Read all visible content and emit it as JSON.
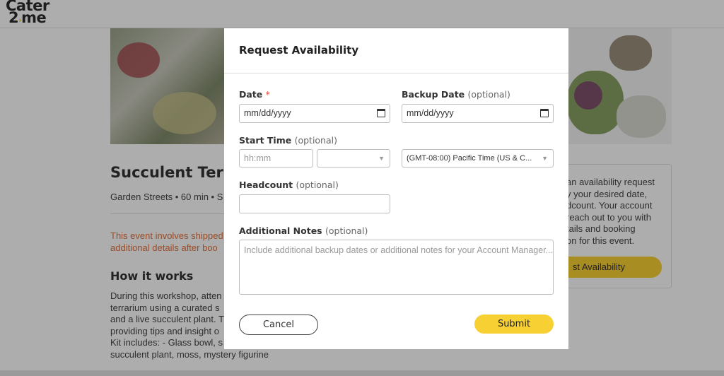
{
  "app": {
    "logo_line1": "Cater",
    "logo_two": "2",
    "logo_me": "me"
  },
  "page": {
    "title": "Succulent Terra",
    "meta": "Garden Streets • 60 min • S",
    "warning_line1": "This event involves shipped",
    "warning_line2": "additional details after boo",
    "how_heading": "How it works",
    "desc_lines": [
      "During this workshop, atten",
      "terrarium using a curated s",
      "and a live succulent plant. T",
      "providing tips and insight o",
      "Kit includes: - Glass bowl, s",
      "succulent plant, moss, mystery figurine"
    ]
  },
  "side_card": {
    "lines": [
      "an availability request",
      "y your desired date,",
      "dcount. Your account",
      "reach out to you with",
      "tails and booking",
      "on for this event."
    ],
    "button_label": "st Availability"
  },
  "modal": {
    "title": "Request Availability",
    "date_label": "Date",
    "date_required": "*",
    "date_placeholder": "mm/dd/yyyy",
    "backup_label": "Backup Date",
    "backup_optional": "(optional)",
    "backup_placeholder": "mm/dd/yyyy",
    "start_label": "Start Time",
    "start_optional": "(optional)",
    "time_placeholder": "hh:mm",
    "ampm_value": "",
    "timezone_value": "(GMT-08:00) Pacific Time (US & C...",
    "headcount_label": "Headcount",
    "headcount_optional": "(optional)",
    "headcount_value": "",
    "notes_label": "Additional Notes",
    "notes_optional": "(optional)",
    "notes_placeholder": "Include additional backup dates or additional notes for your Account Manager...",
    "cancel_label": "Cancel",
    "submit_label": "Submit"
  },
  "colors": {
    "accent": "#f7d033",
    "warning": "#e2703a",
    "required": "#e0452f"
  }
}
